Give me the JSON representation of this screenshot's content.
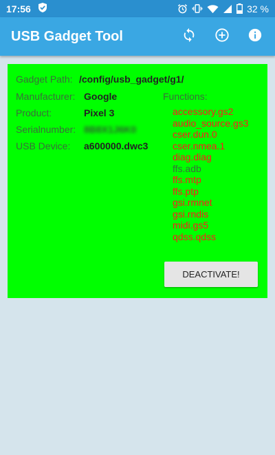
{
  "status_bar": {
    "time": "17:56",
    "battery": "32 %",
    "icons": [
      "shield-check-icon",
      "alarm-icon",
      "vibrate-icon",
      "wifi-icon",
      "signal-icon",
      "battery-icon"
    ]
  },
  "app_bar": {
    "title": "USB Gadget Tool",
    "actions": [
      "sync-icon",
      "add-circle-icon",
      "info-icon"
    ]
  },
  "gadget": {
    "path_label": "Gadget Path:",
    "path_value": "/config/usb_gadget/g1/",
    "fields": [
      {
        "label": "Manufacturer:",
        "value": "Google"
      },
      {
        "label": "Product:",
        "value": "Pixel 3"
      },
      {
        "label": "Serialnumber:",
        "value": "8B8X1J6K0"
      },
      {
        "label": "USB Device:",
        "value": "a600000.dwc3"
      }
    ],
    "functions_label": "Functions:",
    "functions": [
      {
        "name": "accessory.gs2",
        "active": true
      },
      {
        "name": "audio_source.gs3",
        "active": true
      },
      {
        "name": "cser.dun.0",
        "active": true
      },
      {
        "name": "cser.nmea.1",
        "active": true
      },
      {
        "name": "diag.diag",
        "active": true
      },
      {
        "name": "ffs.adb",
        "active": false
      },
      {
        "name": "ffs.mtp",
        "active": true
      },
      {
        "name": "ffs.ptp",
        "active": true
      },
      {
        "name": "gsi.rmnet",
        "active": true
      },
      {
        "name": "gsi.rndis",
        "active": true
      },
      {
        "name": "midi.gs5",
        "active": true
      },
      {
        "name": "qdss.qdss",
        "active": true
      }
    ],
    "button_label": "DEACTIVATE!"
  },
  "colors": {
    "status_bar": "#2a8fcf",
    "app_bar": "#3aa7e3",
    "card": "#00ff00",
    "active_function": "#ff1a1a",
    "inactive_function": "#3b6d3b",
    "background": "#d5e4ec"
  }
}
